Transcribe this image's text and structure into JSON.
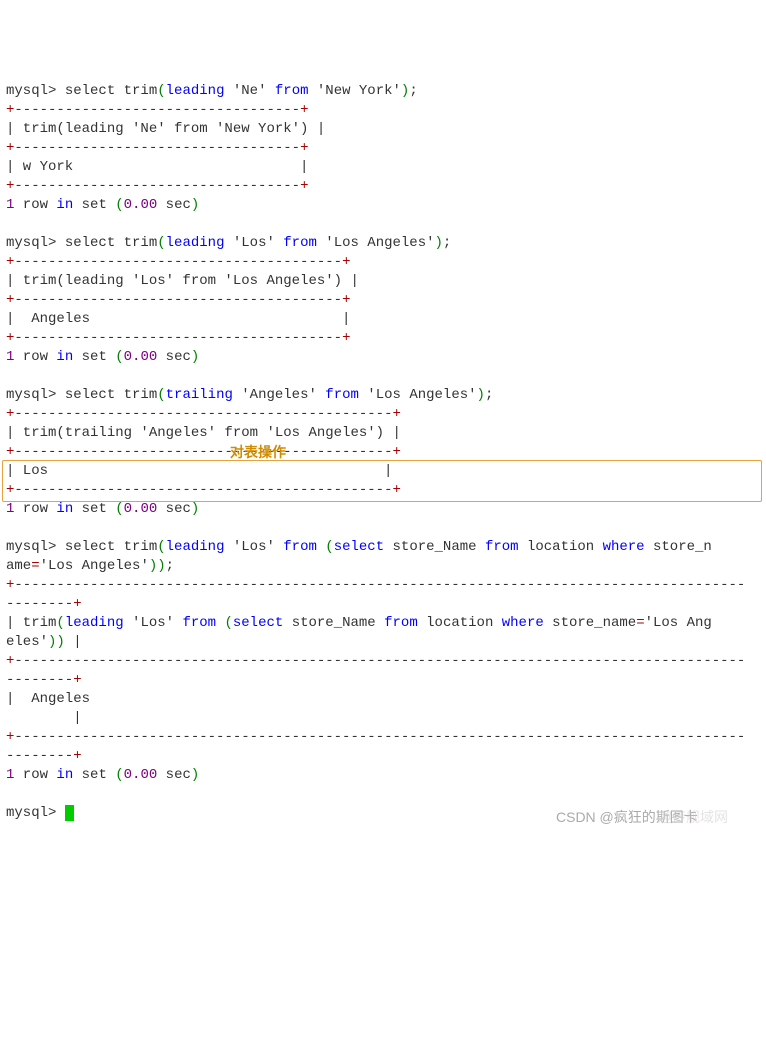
{
  "q1": {
    "prompt": "mysql>",
    "sql_p1": " select trim",
    "sql_p2": "leading",
    "sql_p3": " 'Ne' ",
    "sql_p4": "from",
    "sql_p5": " 'New York'",
    "semi": ";",
    "sep": "+----------------------------------+",
    "col": "| trim(leading 'Ne' from 'New York') |",
    "val": "| w York                           |",
    "rows_a": "1",
    "rows_b": " row ",
    "rows_c": "in",
    "rows_d": " set ",
    "rows_e": "0.00",
    "rows_f": " sec"
  },
  "q2": {
    "prompt": "mysql>",
    "sql_p1": " select trim",
    "sql_p2": "leading",
    "sql_p3": " 'Los' ",
    "sql_p4": "from",
    "sql_p5": " 'Los Angeles'",
    "semi": ";",
    "sep": "+---------------------------------------+",
    "col": "| trim(leading 'Los' from 'Los Angeles') |",
    "val": "|  Angeles                              |",
    "rows_a": "1",
    "rows_b": " row ",
    "rows_c": "in",
    "rows_d": " set ",
    "rows_e": "0.00",
    "rows_f": " sec"
  },
  "q3": {
    "prompt": "mysql>",
    "sql_p1": " select trim",
    "sql_p2": "trailing",
    "sql_p3": " 'Angeles' ",
    "sql_p4": "from",
    "sql_p5": " 'Los Angeles'",
    "semi": ";",
    "sep": "+---------------------------------------------+",
    "col": "| trim(trailing 'Angeles' from 'Los Angeles') |",
    "val": "| Los                                        |",
    "rows_a": "1",
    "rows_b": " row ",
    "rows_c": "in",
    "rows_d": " set ",
    "rows_e": "0.00",
    "rows_f": " sec"
  },
  "annotation": "对表操作",
  "q4": {
    "prompt": "mysql>",
    "sql_p1": " select trim",
    "sql_p2": "leading",
    "sql_p3": " 'Los' ",
    "sql_p4": "from",
    "sql_p5": " ",
    "sql_p6": "select",
    "sql_p7": " store_Name ",
    "sql_p8": "from",
    "sql_p9": " location ",
    "sql_p10": "where",
    "line2_a": " store_n",
    "line2_b": "ame",
    "line2_c": "=",
    "line2_d": "'Los Angeles'",
    "semi": ";",
    "sep1": "+---------------------------------------------------------------------------------------",
    "sep2": "--------+",
    "col1": "| trim",
    "col2": "leading",
    "col3": " 'Los' ",
    "col4": "from",
    "col5": " ",
    "col6": "select",
    "col7": " store_Name ",
    "col8": "from",
    "col9": " location ",
    "col10": "where",
    "col11": " store_name",
    "col12": "=",
    "col13": "'Los Ang",
    "col_line2a": "eles'",
    "col_line2b": " |",
    "val1": "|  Angeles                                                                               ",
    "val2": "        |",
    "rows_a": "1",
    "rows_b": " row ",
    "rows_c": "in",
    "rows_d": " set ",
    "rows_e": "0.00",
    "rows_f": " sec"
  },
  "final_prompt": "mysql> ",
  "watermark1": "CSDN @疯狂的斯图卡",
  "watermark2": "趣传舰域网"
}
